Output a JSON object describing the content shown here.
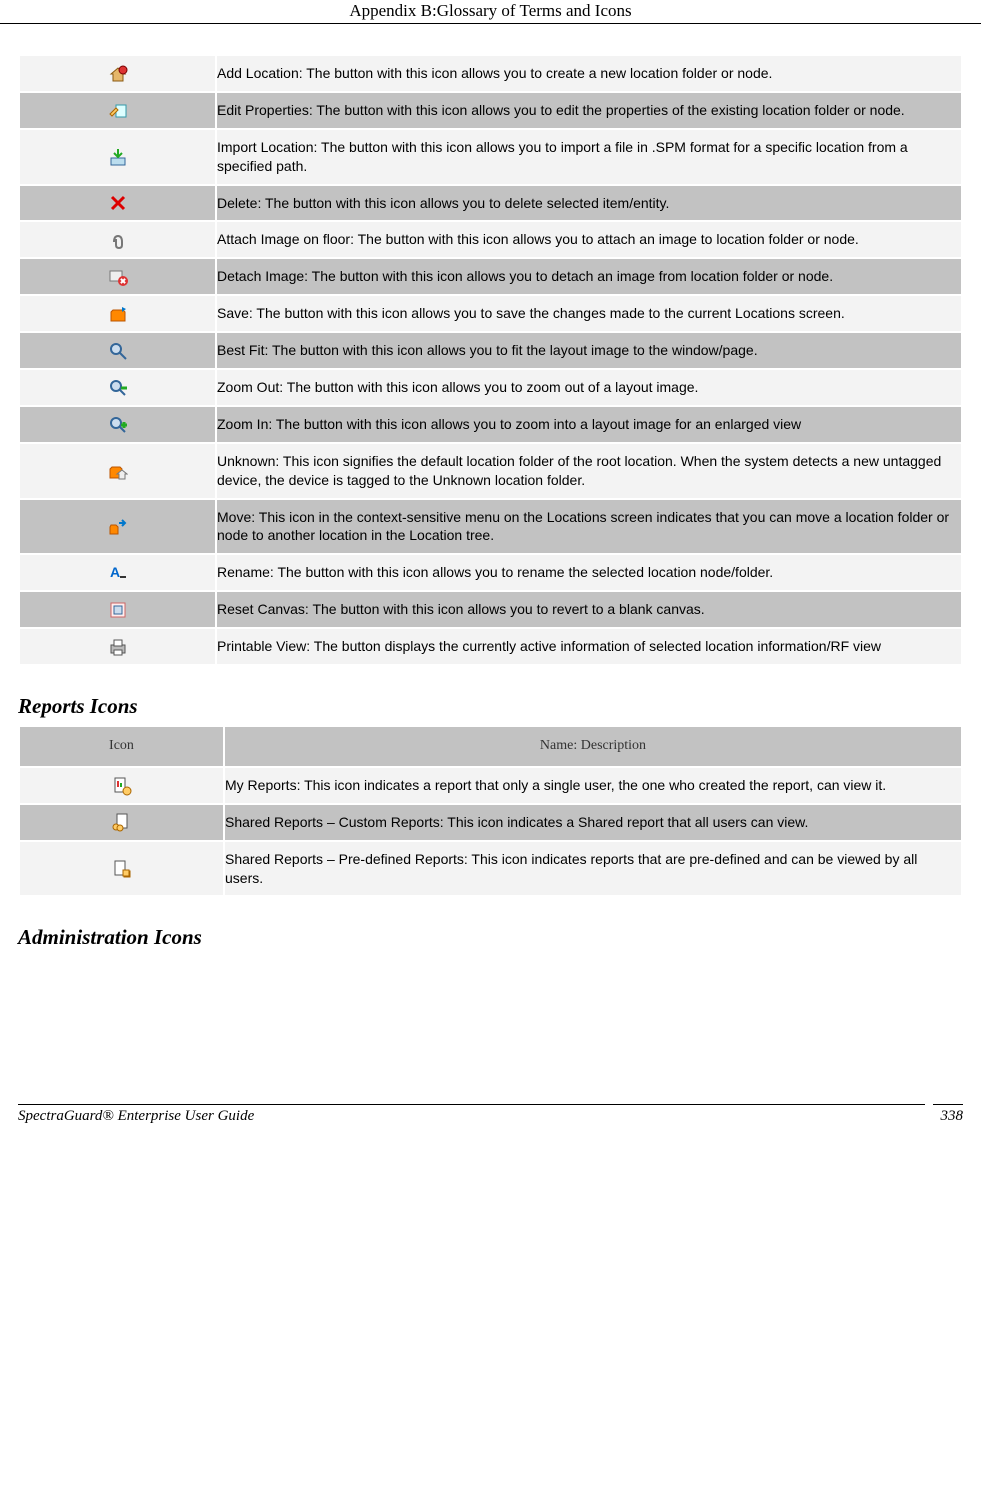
{
  "header": {
    "title": "Appendix B:Glossary of Terms and Icons"
  },
  "location_icons": [
    {
      "icon": "add-location-icon",
      "desc": "Add Location: The button with this icon allows you to create a new location folder or node."
    },
    {
      "icon": "edit-properties-icon",
      "desc": "Edit Properties: The button with this icon allows you to edit the properties of the existing location folder or node."
    },
    {
      "icon": "import-location-icon",
      "desc": "Import Location: The button with this icon allows you to import a file in .SPM format for a specific location from a specified path."
    },
    {
      "icon": "delete-icon",
      "desc": "Delete: The button with this icon allows you to delete selected item/entity."
    },
    {
      "icon": "attach-image-icon",
      "desc": "Attach Image on floor: The button with this icon allows you to attach an image to location folder or node."
    },
    {
      "icon": "detach-image-icon",
      "desc": "Detach Image: The button with this icon allows you to detach an image from location folder or node."
    },
    {
      "icon": "save-icon",
      "desc": "Save: The button with this icon allows you to save the changes made to the current Locations screen."
    },
    {
      "icon": "best-fit-icon",
      "desc": "Best Fit: The button with this icon allows you to fit the layout image to the window/page."
    },
    {
      "icon": "zoom-out-icon",
      "desc": "Zoom Out: The button with this icon allows you to zoom out of a layout image."
    },
    {
      "icon": "zoom-in-icon",
      "desc": "Zoom In: The button with this icon allows you to zoom into a layout image for an enlarged view"
    },
    {
      "icon": "unknown-icon",
      "desc": "Unknown: This icon signifies the default location folder of the root location. When the system detects a new untagged device, the device is tagged to the Unknown location folder."
    },
    {
      "icon": "move-icon",
      "desc": "Move: This icon in the context-sensitive menu on the Locations screen indicates that you can move a location folder or node to another location in the Location tree."
    },
    {
      "icon": "rename-icon",
      "desc": "Rename: The button with this icon allows you to rename the selected location node/folder."
    },
    {
      "icon": "reset-canvas-icon",
      "desc": "Reset Canvas: The button with this icon allows you to revert to a blank canvas."
    },
    {
      "icon": "printable-view-icon",
      "desc": "Printable View: The button displays the currently active information of selected location information/RF view"
    }
  ],
  "reports_section": {
    "heading": "Reports Icons",
    "header_icon": "Icon",
    "header_desc": "Name: Description"
  },
  "reports_icons": [
    {
      "icon": "my-reports-icon",
      "desc": "My Reports: This icon indicates a report that only a single user, the one who created the report, can view it."
    },
    {
      "icon": "shared-reports-custom-icon",
      "desc": "Shared Reports – Custom Reports: This icon indicates a Shared report that all users can view."
    },
    {
      "icon": "shared-reports-predef-icon",
      "desc": "Shared Reports – Pre-defined Reports: This icon indicates reports that are pre-defined and can be viewed by all users."
    }
  ],
  "admin_section": {
    "heading": "Administration Icons"
  },
  "footer": {
    "title": "SpectraGuard® Enterprise User Guide",
    "page": "338"
  }
}
